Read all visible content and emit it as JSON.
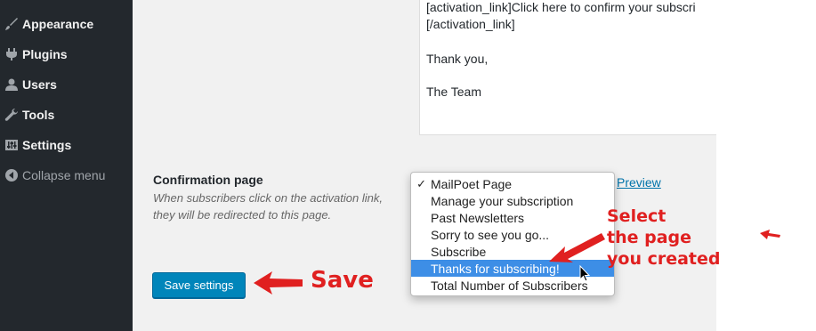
{
  "sidebar": {
    "items": [
      {
        "label": "Appearance",
        "icon": "paintbrush-icon"
      },
      {
        "label": "Plugins",
        "icon": "plugin-icon"
      },
      {
        "label": "Users",
        "icon": "users-icon"
      },
      {
        "label": "Tools",
        "icon": "wrench-icon"
      },
      {
        "label": "Settings",
        "icon": "settings-icon"
      },
      {
        "label": "Collapse menu",
        "icon": "collapse-icon"
      }
    ]
  },
  "editor": {
    "lines": [
      "[activation_link]Click here to confirm your subscri",
      "[/activation_link]",
      "Thank you,",
      "The Team"
    ]
  },
  "confirmation": {
    "title": "Confirmation page",
    "description": "When subscribers click on the activation link, they will be redirected to this page.",
    "preview_label": "Preview"
  },
  "dropdown": {
    "selected": "MailPoet Page",
    "highlighted": "Thanks for subscribing!",
    "options": [
      "MailPoet Page",
      "Manage your subscription",
      "Past Newsletters",
      "Sorry to see you go...",
      "Subscribe",
      "Thanks for subscribing!",
      "Total Number of Subscribers"
    ]
  },
  "save_button": {
    "label": "Save settings"
  },
  "annotations": {
    "save": "Save",
    "select_lines": [
      "Select",
      "the page",
      "you created"
    ]
  },
  "colors": {
    "sidebar_bg": "#23282d",
    "content_bg": "#f1f1f1",
    "primary_button": "#0085ba",
    "highlight": "#3d8ee6",
    "annotation_red": "#e02020",
    "link": "#0073aa"
  }
}
